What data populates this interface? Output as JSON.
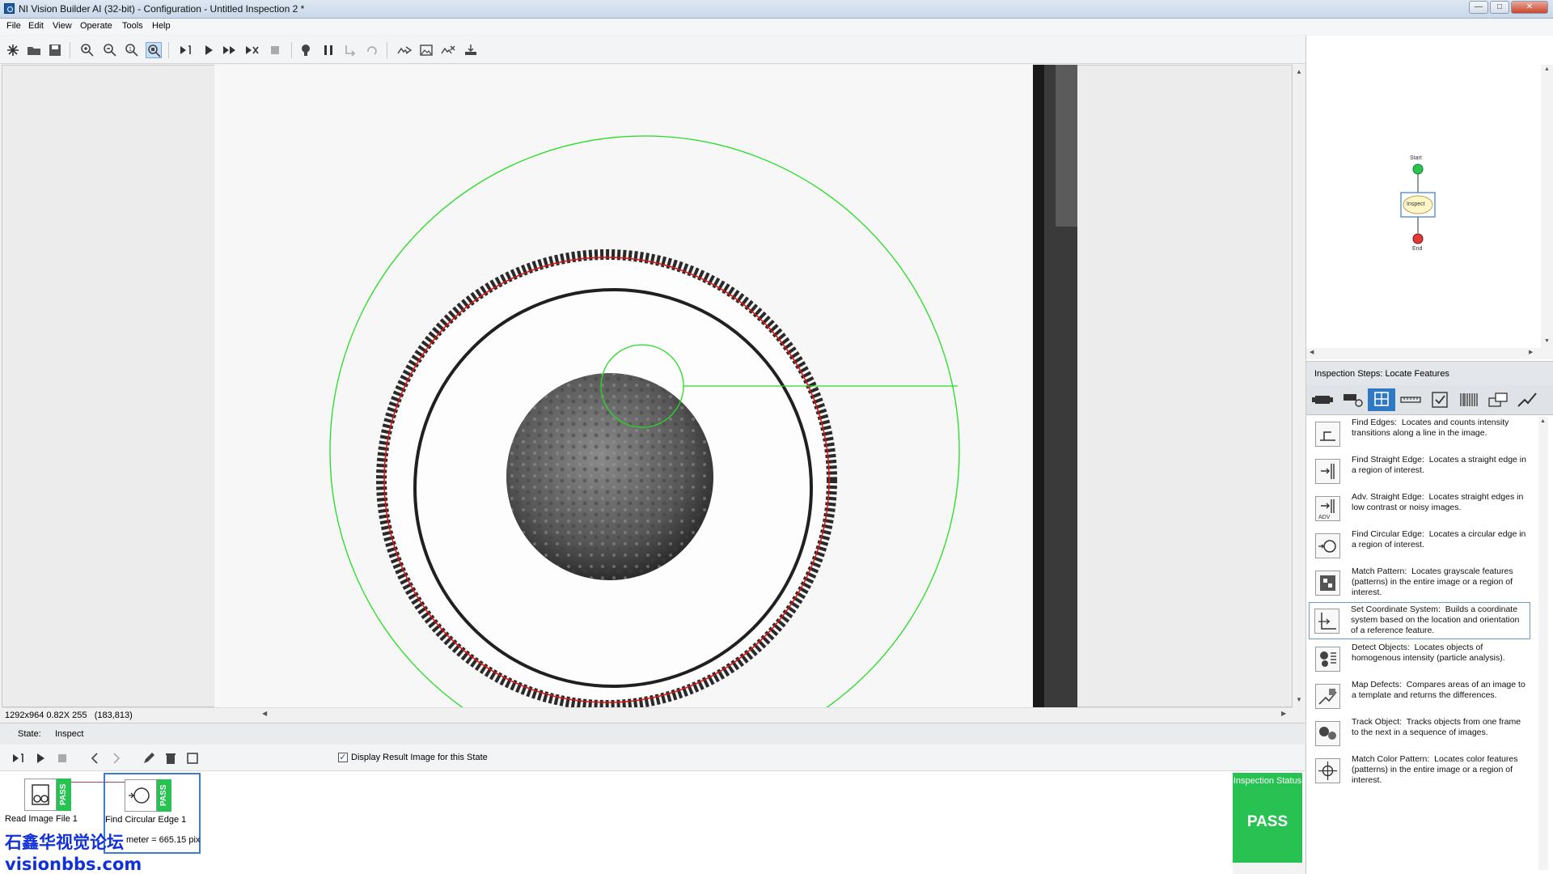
{
  "window": {
    "title": "NI Vision Builder AI (32-bit) - Configuration - Untitled Inspection 2 *"
  },
  "menu": [
    "File",
    "Edit",
    "View",
    "Operate",
    "Tools",
    "Help"
  ],
  "image_view": {
    "info": "1292x964 0.82X 255",
    "coords": "(183,813)"
  },
  "state_bar": {
    "label": "State:",
    "value": "Inspect"
  },
  "display_result": {
    "label": "Display Result Image for this State",
    "checked": true
  },
  "steps": [
    {
      "label": "Read Image File 1",
      "status": "PASS"
    },
    {
      "label": "Find Circular Edge 1",
      "status": "PASS",
      "result": "Diameter = 665.15 pix",
      "result_visible": "meter = 665.15 pix"
    }
  ],
  "inspection_status": {
    "title": "Inspection Status",
    "value": "PASS"
  },
  "flowchart": {
    "start": "Start",
    "state": "Inspect",
    "end": "End"
  },
  "inspection_steps": {
    "header": "Inspection Steps: Locate Features",
    "items": [
      {
        "name": "Find Edges:",
        "desc": "Locates and counts intensity transitions along a line in the image.",
        "icon": "find-edges-icon"
      },
      {
        "name": "Find Straight Edge:",
        "desc": "Locates a straight edge in a region of interest.",
        "icon": "straight-edge-icon"
      },
      {
        "name": "Adv. Straight Edge:",
        "desc": "Locates straight edges in low contrast or noisy images.",
        "icon": "adv-straight-edge-icon"
      },
      {
        "name": "Find Circular Edge:",
        "desc": "Locates a circular edge in a region of interest.",
        "icon": "circular-edge-icon"
      },
      {
        "name": "Match Pattern:",
        "desc": "Locates grayscale features (patterns) in the entire image or a region of interest.",
        "icon": "match-pattern-icon"
      },
      {
        "name": "Set Coordinate System:",
        "desc": "Builds a coordinate system based on the location and orientation of a reference feature.",
        "icon": "coordinate-system-icon"
      },
      {
        "name": "Detect Objects:",
        "desc": "Locates objects of homogenous intensity (particle analysis).",
        "icon": "detect-objects-icon"
      },
      {
        "name": "Map Defects:",
        "desc": "Compares areas of an image to a template and returns the differences.",
        "icon": "map-defects-icon"
      },
      {
        "name": "Track Object:",
        "desc": "Tracks objects from one frame to the next in a sequence of images.",
        "icon": "track-object-icon"
      },
      {
        "name": "Match Color Pattern:",
        "desc": "Locates color features (patterns) in the entire image or a region of interest.",
        "icon": "color-pattern-icon"
      }
    ]
  },
  "watermark": {
    "line1": "石鑫华视觉论坛",
    "line2": "visionbbs.com"
  },
  "colors": {
    "pass": "#27c252",
    "roi": "#22dd22",
    "edge": "#e01010",
    "selected_category": "#2f78c4"
  }
}
